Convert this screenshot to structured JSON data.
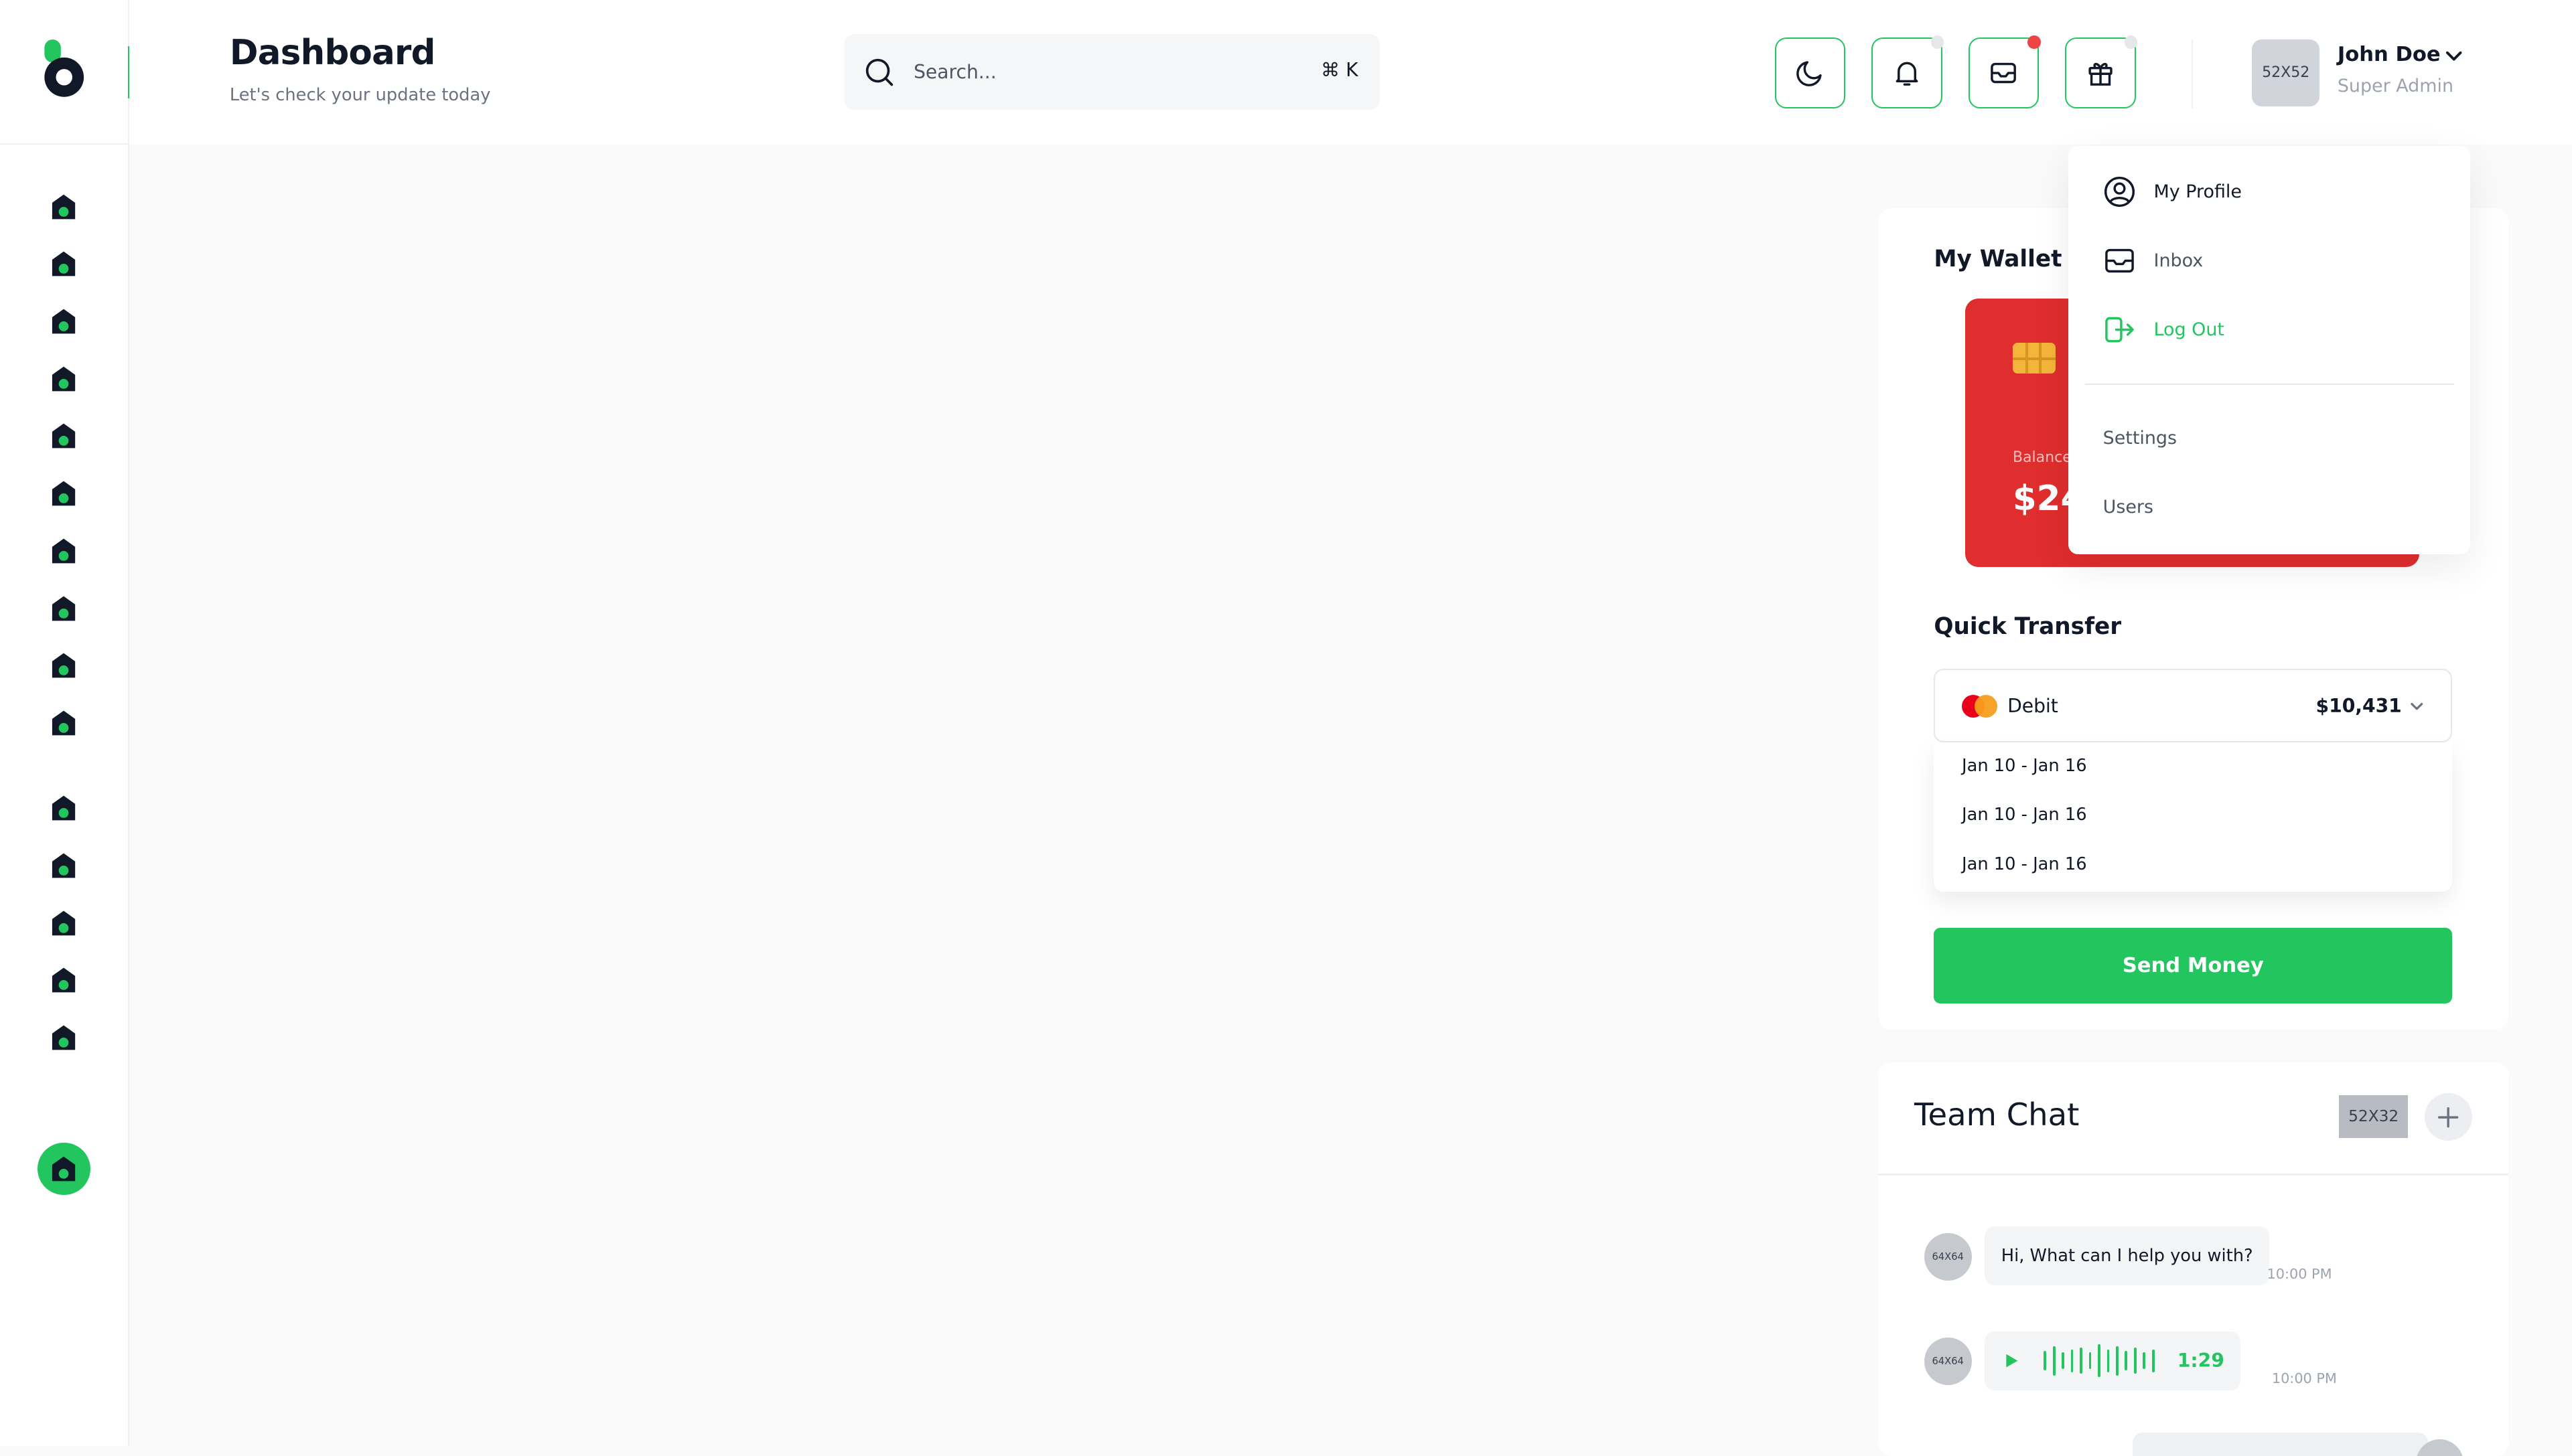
{
  "header": {
    "title": "Dashboard",
    "subtitle": "Let's check your update today",
    "search_placeholder": "Search...",
    "search_shortcut": "⌘ K"
  },
  "user": {
    "avatar_text": "52X52",
    "name": "John Doe",
    "role": "Super Admin"
  },
  "profile_menu": {
    "items": [
      "My Profile",
      "Inbox",
      "Log Out"
    ],
    "links": [
      "Settings",
      "Users"
    ]
  },
  "wallet": {
    "title": "My Wallet",
    "balance_label": "Balance",
    "balance_visible": "$24"
  },
  "transfer": {
    "title": "Quick Transfer",
    "account_type": "Debit",
    "account_amount": "$10,431",
    "date_options": [
      "Jan 10 - Jan 16",
      "Jan 10 - Jan 16",
      "Jan 10 - Jan 16"
    ],
    "send_label": "Send Money"
  },
  "chat": {
    "title": "Team Chat",
    "thumb_text": "52X32",
    "messages": [
      {
        "avatar": "64X64",
        "text": "Hi, What can I help you with?",
        "time": "10:00 PM"
      },
      {
        "avatar": "64X64",
        "duration": "1:29",
        "time": "10:00 PM"
      }
    ]
  },
  "colors": {
    "accent": "#22c55e",
    "card_red": "#e02d2d",
    "notification_red": "#ef4444",
    "neutral_dot": "#e5e7eb"
  },
  "icons": [
    "moon-icon",
    "bell-icon",
    "mail-icon",
    "gift-icon",
    "home-icon",
    "search-icon",
    "user-circle-icon",
    "inbox-icon",
    "logout-icon",
    "chevron-down-icon",
    "plus-icon",
    "play-icon"
  ]
}
